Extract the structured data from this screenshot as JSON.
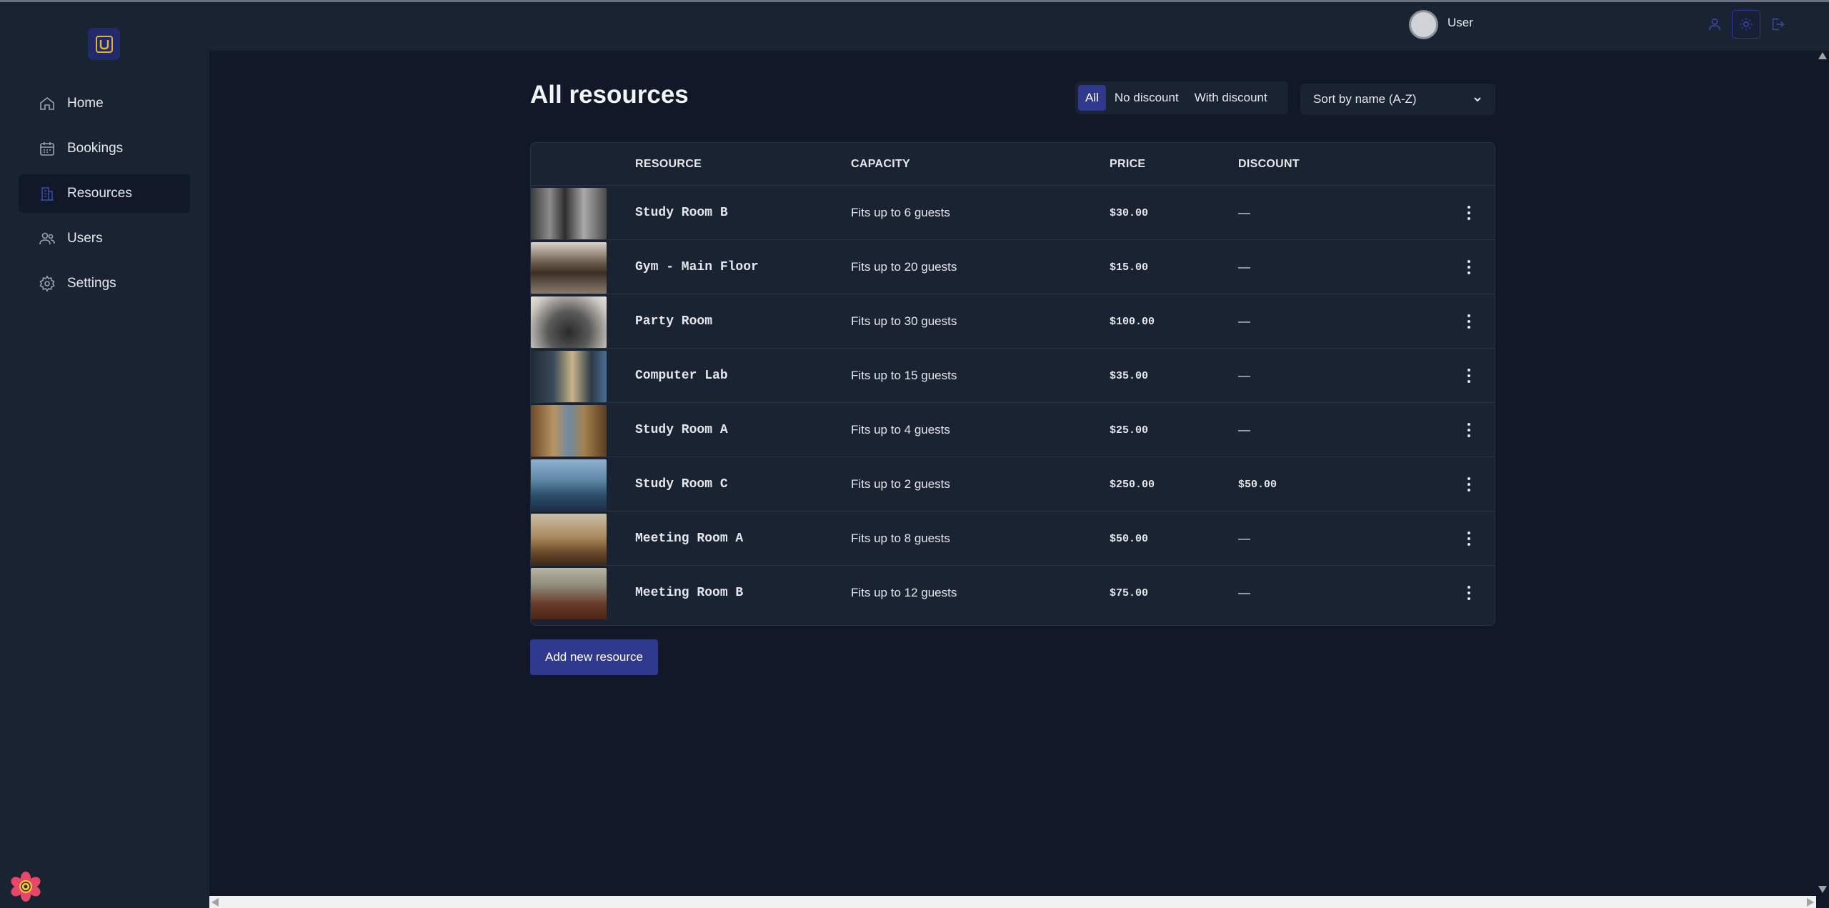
{
  "sidebar": {
    "logo_icon": "app-logo-icon",
    "items": [
      {
        "label": "Home",
        "icon": "home-icon"
      },
      {
        "label": "Bookings",
        "icon": "calendar-icon"
      },
      {
        "label": "Resources",
        "icon": "building-icon",
        "active": true
      },
      {
        "label": "Users",
        "icon": "users-icon"
      },
      {
        "label": "Settings",
        "icon": "gear-icon"
      }
    ]
  },
  "topbar": {
    "user_label": "User"
  },
  "main": {
    "title": "All resources",
    "filters": [
      "All",
      "No discount",
      "With discount"
    ],
    "active_filter": "All",
    "sort_value": "Sort by name (A-Z)",
    "table": {
      "headers": {
        "resource": "RESOURCE",
        "capacity": "CAPACITY",
        "price": "PRICE",
        "discount": "DISCOUNT"
      },
      "rows": [
        {
          "name": "Study Room B",
          "capacity": "Fits up to 6 guests",
          "price": "$30.00",
          "discount": "—"
        },
        {
          "name": "Gym - Main Floor",
          "capacity": "Fits up to 20 guests",
          "price": "$15.00",
          "discount": "—"
        },
        {
          "name": "Party Room",
          "capacity": "Fits up to 30 guests",
          "price": "$100.00",
          "discount": "—"
        },
        {
          "name": "Computer Lab",
          "capacity": "Fits up to 15 guests",
          "price": "$35.00",
          "discount": "—"
        },
        {
          "name": "Study Room A",
          "capacity": "Fits up to 4 guests",
          "price": "$25.00",
          "discount": "—"
        },
        {
          "name": "Study Room C",
          "capacity": "Fits up to 2 guests",
          "price": "$250.00",
          "discount": "$50.00"
        },
        {
          "name": "Meeting Room A",
          "capacity": "Fits up to 8 guests",
          "price": "$50.00",
          "discount": "—"
        },
        {
          "name": "Meeting Room B",
          "capacity": "Fits up to 12 guests",
          "price": "$75.00",
          "discount": "—"
        }
      ]
    },
    "add_button": "Add new resource"
  },
  "colors": {
    "background": "#111827",
    "panel": "#1a2332",
    "accent": "#2f3a8f",
    "logo_accent": "#e0b33a"
  }
}
